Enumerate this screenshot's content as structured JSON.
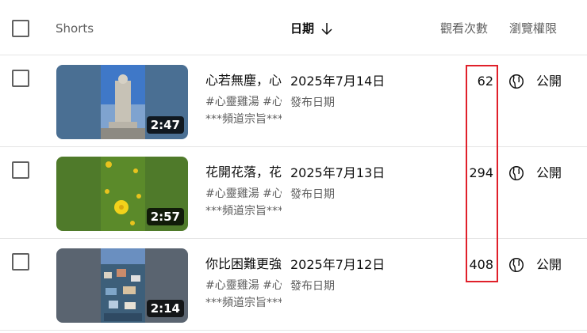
{
  "header": {
    "col_shorts": "Shorts",
    "col_date": "日期",
    "col_views": "觀看次數",
    "col_visibility": "瀏覽權限"
  },
  "rows": [
    {
      "title": "心若無塵，心若無塵，",
      "desc_line1": "#心靈雞湯 #心靈雞湯",
      "desc_line2": "***頻道宗旨***",
      "duration": "2:47",
      "date": "2025年7月14日",
      "date_sub": "發布日期",
      "views": "62",
      "visibility": "公開"
    },
    {
      "title": "花開花落，花開花落，",
      "desc_line1": "#心靈雞湯 #心靈雞湯",
      "desc_line2": "***頻道宗旨***",
      "duration": "2:57",
      "date": "2025年7月13日",
      "date_sub": "發布日期",
      "views": "294",
      "visibility": "公開"
    },
    {
      "title": "你比困難更強大，",
      "desc_line1": "#心靈雞湯 #心靈雞湯",
      "desc_line2": "***頻道宗旨***",
      "duration": "2:14",
      "date": "2025年7月12日",
      "date_sub": "發布日期",
      "views": "408",
      "visibility": "公開"
    }
  ],
  "colors": {
    "highlight": "#e0202a",
    "thumb1_bg": "#4a6f93",
    "thumb2_bg": "#4f7a2a",
    "thumb3_bg": "#5a6470"
  },
  "icons": {
    "sort": "arrow-down-icon",
    "visibility": "globe-icon"
  }
}
